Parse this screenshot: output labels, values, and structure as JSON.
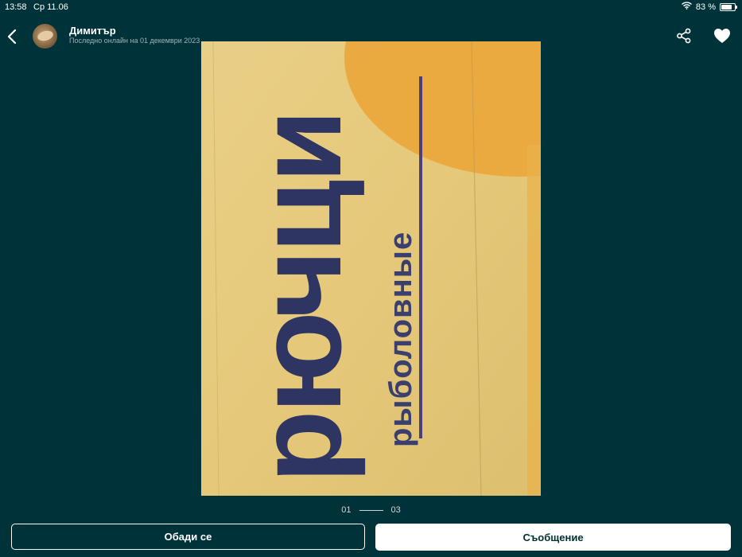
{
  "status_bar": {
    "time": "13:58",
    "date": "Ср 11.06",
    "battery_text": "83 %",
    "battery_level": 0.83,
    "wifi_icon": "wifi-icon"
  },
  "header": {
    "back_icon": "chevron-left-icon",
    "user_name": "Димитър",
    "last_online": "Последно онлайн на 01 декември 2023",
    "share_icon": "share-icon",
    "favorite_icon": "heart-icon"
  },
  "photo": {
    "text_large": "рючци",
    "text_small": "рыболовные"
  },
  "pager": {
    "current": "01",
    "total": "03"
  },
  "actions": {
    "call_label": "Обади се",
    "message_label": "Съобщение"
  },
  "colors": {
    "background": "#00323a",
    "button_primary": "#ffffff",
    "text_dark": "#002f34"
  }
}
